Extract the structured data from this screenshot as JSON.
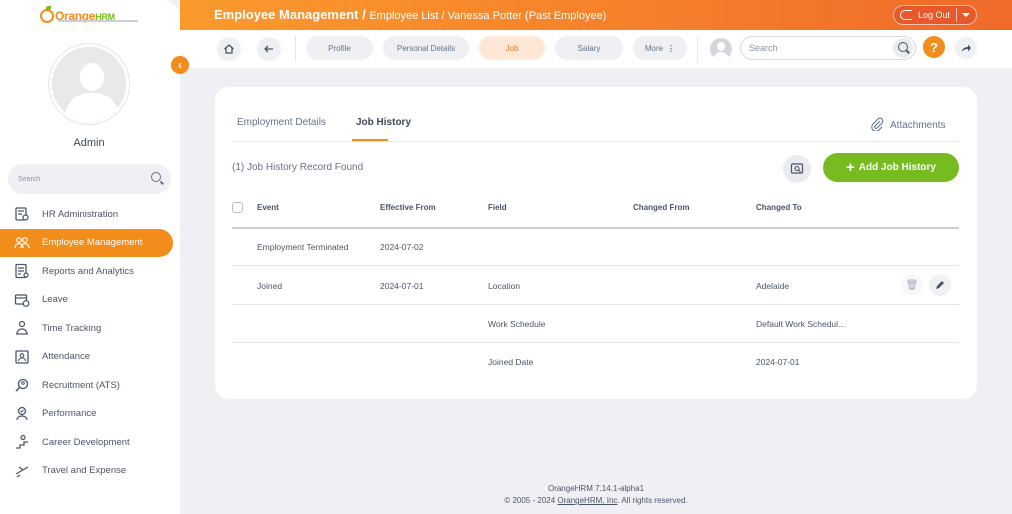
{
  "logo": {
    "brand": "Orange",
    "suffix": "HRM"
  },
  "sidebar": {
    "user_name": "Admin",
    "search_placeholder": "Search",
    "items": [
      {
        "label": "HR Administration",
        "icon": "hr-admin-icon"
      },
      {
        "label": "Employee Management",
        "icon": "employee-mgmt-icon",
        "active": true
      },
      {
        "label": "Reports and Analytics",
        "icon": "reports-icon"
      },
      {
        "label": "Leave",
        "icon": "leave-icon"
      },
      {
        "label": "Time Tracking",
        "icon": "time-icon"
      },
      {
        "label": "Attendance",
        "icon": "attendance-icon"
      },
      {
        "label": "Recruitment (ATS)",
        "icon": "recruitment-icon"
      },
      {
        "label": "Performance",
        "icon": "performance-icon"
      },
      {
        "label": "Career Development",
        "icon": "career-icon"
      },
      {
        "label": "Travel and Expense",
        "icon": "travel-icon"
      }
    ]
  },
  "header": {
    "title": "Employee Management / ",
    "breadcrumb": "Employee List",
    "employee": " / Vanessa Potter (Past Employee)",
    "logout_label": "Log Out"
  },
  "toolbar": {
    "tabs": [
      "Profile",
      "Personal Details",
      "Job",
      "Salary",
      "More"
    ],
    "active_tab": "Job",
    "search_placeholder": "Search",
    "help_label": "?"
  },
  "card": {
    "tabs": [
      "Employment Details",
      "Job History"
    ],
    "active_tab": "Job History",
    "attachments_label": "Attachments",
    "records_found": "(1) Job History Record Found",
    "add_button_label": "Add Job History",
    "columns": [
      "Event",
      "Effective From",
      "Field",
      "Changed From",
      "Changed To"
    ],
    "rows": [
      {
        "event": "Employment Terminated",
        "effective_from": "2024-07-02",
        "field": "",
        "changed_from": "",
        "changed_to": ""
      },
      {
        "event": "Joined",
        "effective_from": "2024-07-01",
        "field": "Location",
        "changed_from": "",
        "changed_to": "Adelaide"
      },
      {
        "event": "",
        "effective_from": "",
        "field": "Work Schedule",
        "changed_from": "",
        "changed_to": "Default Work Schedul..."
      },
      {
        "event": "",
        "effective_from": "",
        "field": "Joined Date",
        "changed_from": "",
        "changed_to": "2024-07-01"
      }
    ]
  },
  "footer": {
    "version": "OrangeHRM 7.14.1-alpha1",
    "copyright_prefix": "© 2005 - 2024 ",
    "company_link": "OrangeHRM, Inc",
    "copyright_suffix": ". All rights reserved."
  },
  "colors": {
    "accent": "#f28c1a",
    "success": "#76bc21",
    "header_end": "#f06a2a"
  }
}
